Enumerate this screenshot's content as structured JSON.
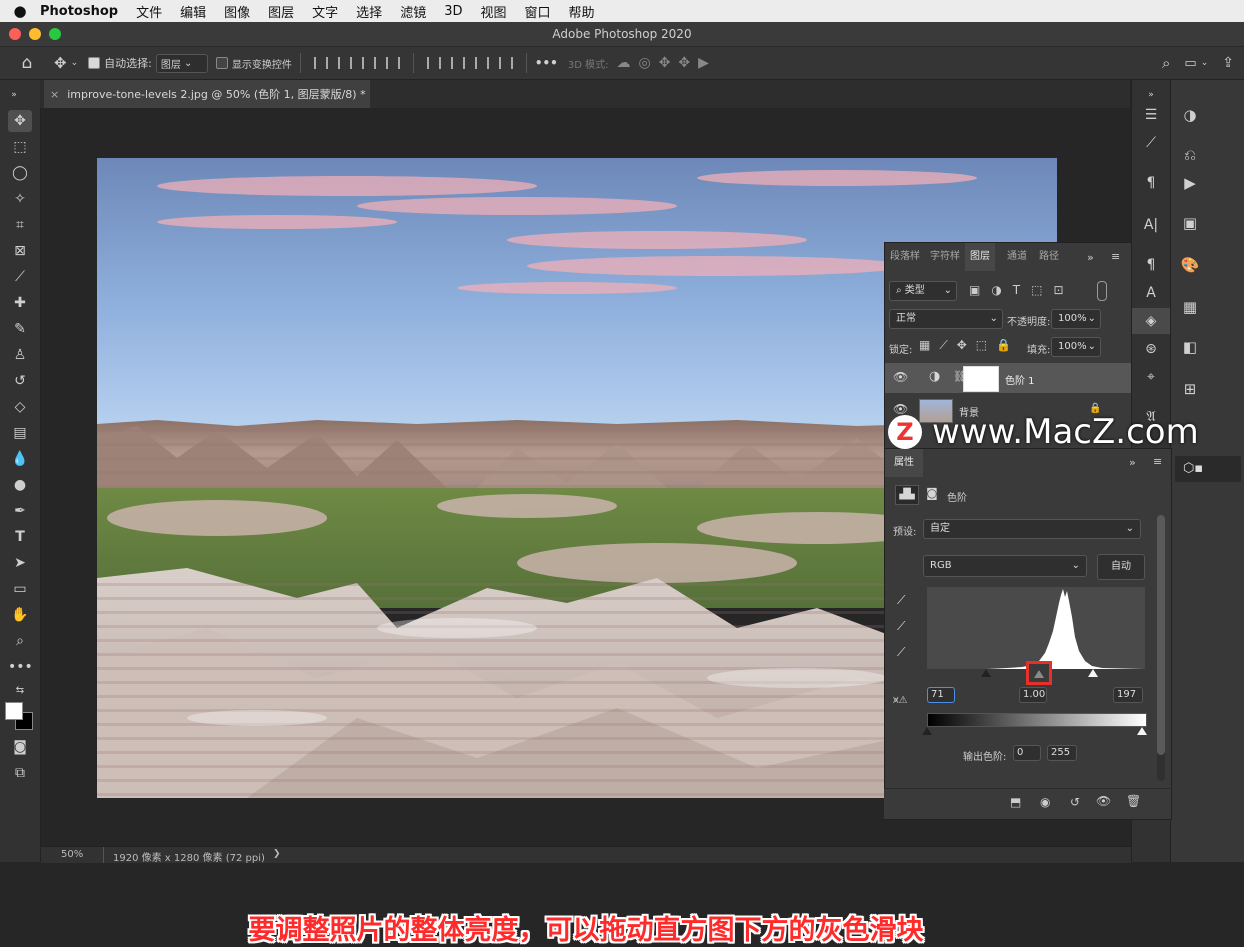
{
  "menubar": {
    "apple": "",
    "app_name": "Photoshop",
    "items": [
      "文件",
      "编辑",
      "图像",
      "图层",
      "文字",
      "选择",
      "滤镜",
      "3D",
      "视图",
      "窗口",
      "帮助"
    ]
  },
  "window": {
    "title": "Adobe Photoshop 2020"
  },
  "options_bar": {
    "auto_select_label": "自动选择:",
    "auto_select_value": "图层",
    "show_transform_label": "显示变换控件",
    "mode_3d_label": "3D 模式:",
    "more": "•••"
  },
  "document_tab": {
    "close": "×",
    "title": "improve-tone-levels 2.jpg @ 50% (色阶 1, 图层蒙版/8) *"
  },
  "layers_panel": {
    "tabs": [
      "段落样",
      "字符样",
      "图层",
      "通道",
      "路径"
    ],
    "active_tab": "图层",
    "filter_label": "类型",
    "blend_mode": "正常",
    "opacity_label": "不透明度:",
    "opacity_value": "100%",
    "lock_label": "锁定:",
    "fill_label": "填充:",
    "fill_value": "100%",
    "layers": [
      {
        "name": "色阶 1",
        "type": "adjustment",
        "selected": true
      },
      {
        "name": "背景",
        "type": "image",
        "locked": true
      }
    ]
  },
  "properties_panel": {
    "title": "属性",
    "subtitle": "色阶",
    "preset_label": "预设:",
    "preset_value": "自定",
    "channel_value": "RGB",
    "auto_button": "自动",
    "input_black": "71",
    "input_gamma": "1.00",
    "input_white": "197",
    "output_label": "输出色阶:",
    "output_black": "0",
    "output_white": "255",
    "gamma_slider_position": 0.5
  },
  "status_bar": {
    "zoom": "50%",
    "doc_info": "1920 像素 x 1280 像素 (72 ppi)",
    "arrow": "❯"
  },
  "watermark": {
    "logo": "Z",
    "text": "www.MacZ.com"
  },
  "subtitle": "要调整照片的整体亮度，可以拖动直方图下方的灰色滑块",
  "colors": {
    "ui_dark": "#323232",
    "panel": "#3a3a3a",
    "highlight_box": "#e8302a",
    "subtitle_red": "#ff2a2a"
  }
}
